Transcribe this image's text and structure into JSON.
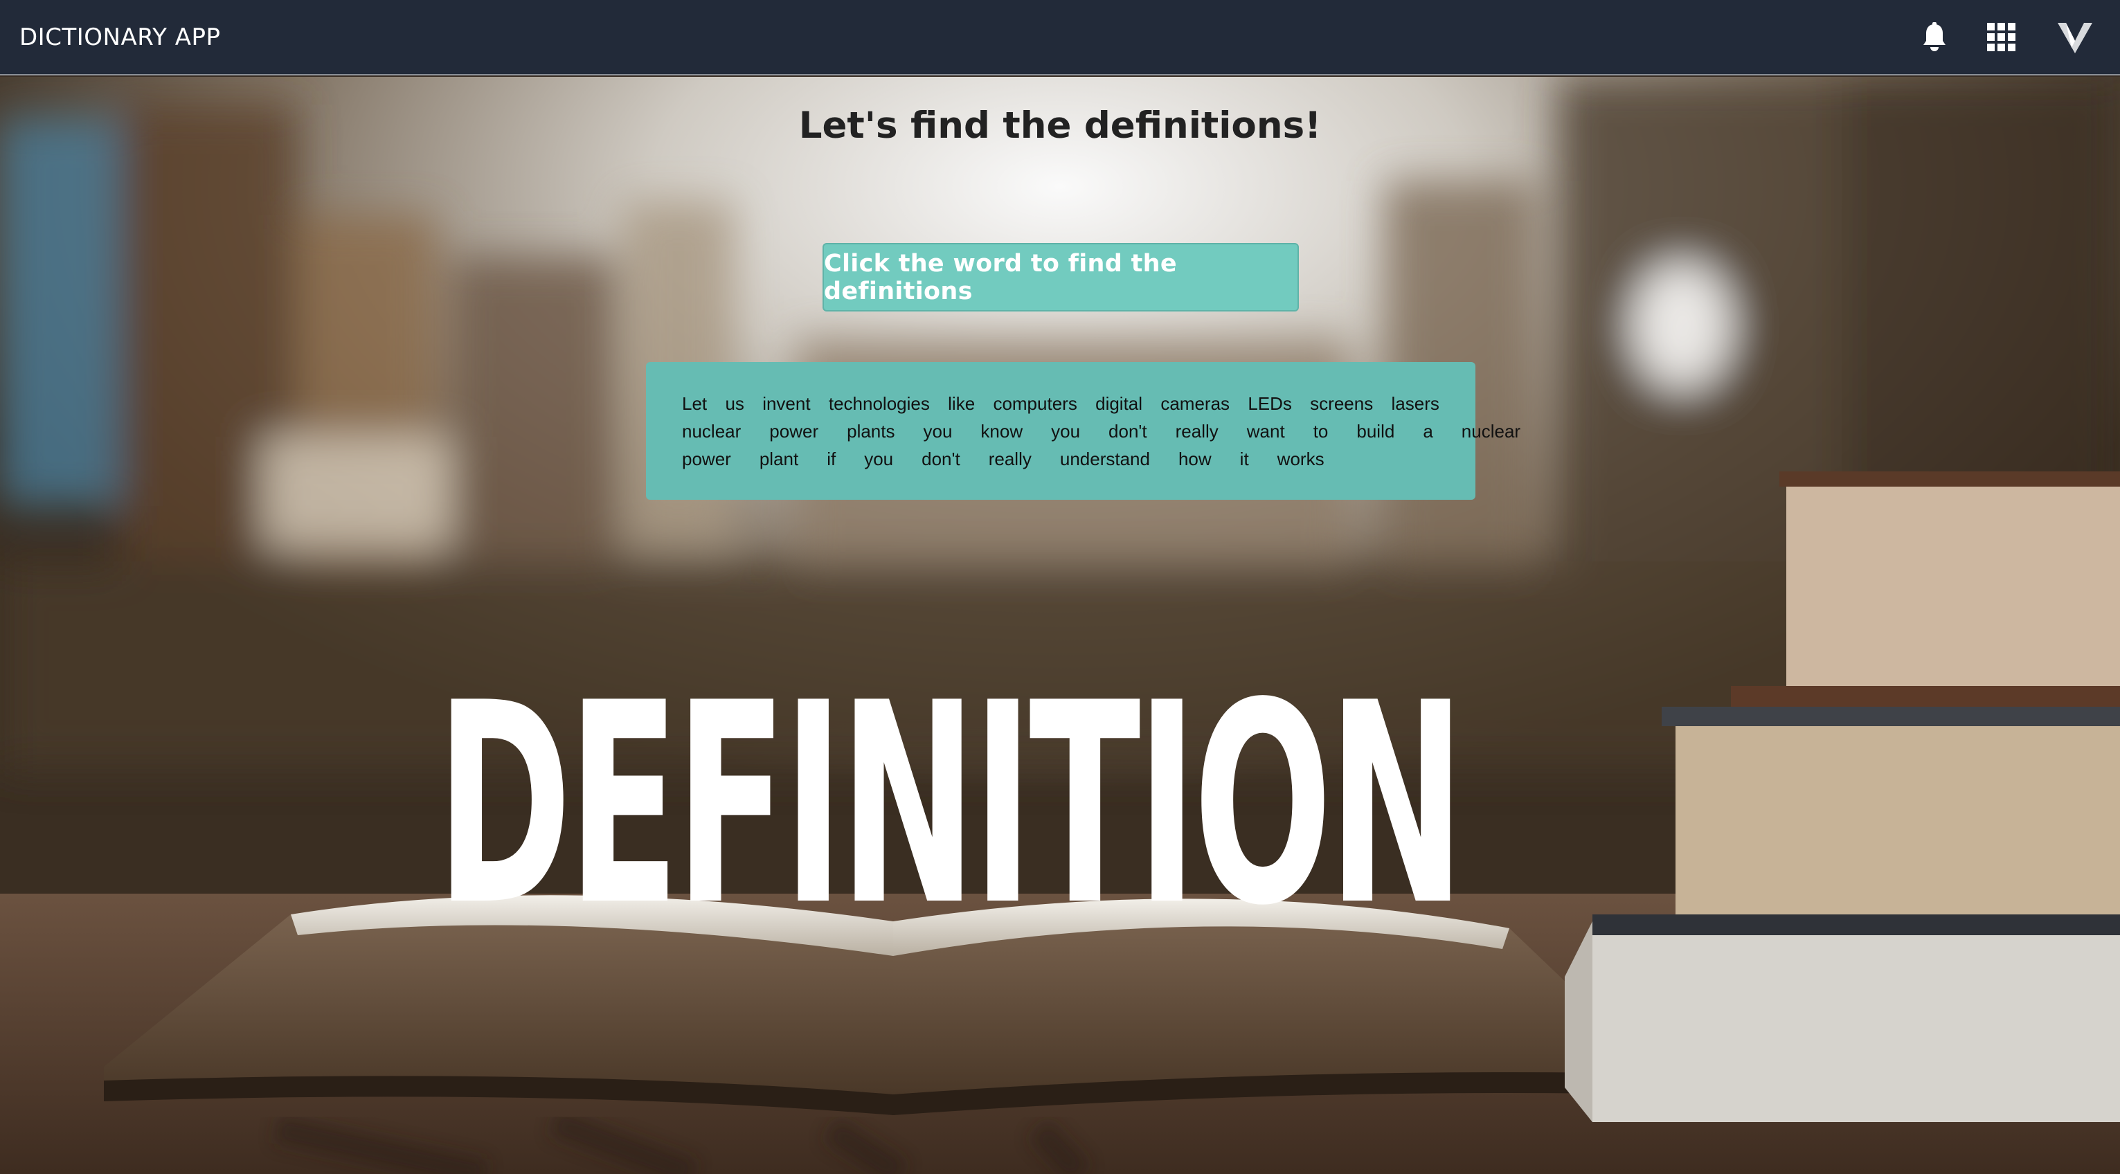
{
  "header": {
    "brand": "DICTIONARY APP",
    "icons": [
      "bell-icon",
      "apps-grid-icon",
      "logo-v-icon"
    ]
  },
  "main": {
    "title": "Let's find the definitions!",
    "find_button_label": "Click the word to find the definitions",
    "passage_lines": [
      [
        "Let",
        "us",
        "invent",
        "technologies",
        "like",
        "computers",
        "digital",
        "cameras",
        "LEDs",
        "screens",
        "lasers"
      ],
      [
        "nuclear",
        "power",
        "plants",
        "you",
        "know",
        "you",
        "don't",
        "really",
        "want",
        "to",
        "build",
        "a",
        "nuclear"
      ],
      [
        "power",
        "plant",
        "if",
        "you",
        "don't",
        "really",
        "understand",
        "how",
        "it",
        "works"
      ]
    ]
  },
  "background": {
    "hero_word": "DEFINITION"
  },
  "colors": {
    "topbar": "#222a39",
    "button": "#72cbbf",
    "passage_box": "#66bcb3"
  }
}
